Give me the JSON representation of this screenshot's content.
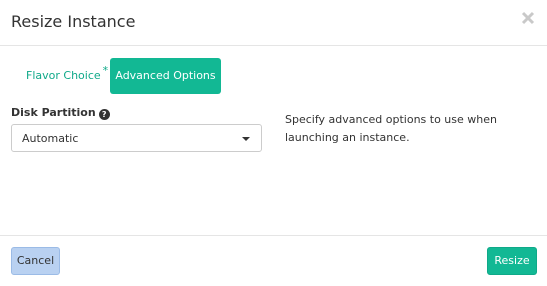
{
  "modal": {
    "title": "Resize Instance",
    "close_icon": "close-icon"
  },
  "tabs": [
    {
      "label": "Flavor Choice",
      "required_marker": "*",
      "active": false
    },
    {
      "label": "Advanced Options",
      "active": true
    }
  ],
  "disk_partition": {
    "label": "Disk Partition",
    "help_icon": "question-circle-icon",
    "selected": "Automatic"
  },
  "help_text": "Specify advanced options to use when launching an instance.",
  "footer": {
    "cancel_label": "Cancel",
    "resize_label": "Resize"
  },
  "colors": {
    "accent": "#12b894",
    "accent_text": "#0fa989",
    "cancel_bg": "#b9d1f1"
  }
}
